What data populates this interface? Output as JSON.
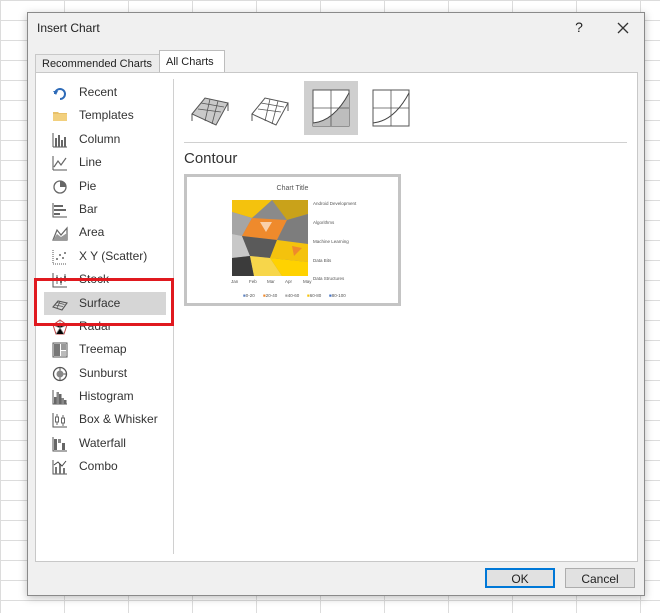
{
  "dialog": {
    "title": "Insert Chart",
    "help": "?",
    "tabs": [
      {
        "label": "Recommended Charts"
      },
      {
        "label": "All Charts"
      }
    ]
  },
  "sidebar": {
    "items": [
      {
        "label": "Recent",
        "icon": "recent-icon"
      },
      {
        "label": "Templates",
        "icon": "folder-icon"
      },
      {
        "label": "Column",
        "icon": "column-chart-icon"
      },
      {
        "label": "Line",
        "icon": "line-chart-icon"
      },
      {
        "label": "Pie",
        "icon": "pie-chart-icon"
      },
      {
        "label": "Bar",
        "icon": "bar-chart-icon"
      },
      {
        "label": "Area",
        "icon": "area-chart-icon"
      },
      {
        "label": "X Y (Scatter)",
        "icon": "scatter-chart-icon"
      },
      {
        "label": "Stock",
        "icon": "stock-chart-icon"
      },
      {
        "label": "Surface",
        "icon": "surface-chart-icon",
        "selected": true
      },
      {
        "label": "Radar",
        "icon": "radar-chart-icon"
      },
      {
        "label": "Treemap",
        "icon": "treemap-chart-icon"
      },
      {
        "label": "Sunburst",
        "icon": "sunburst-chart-icon"
      },
      {
        "label": "Histogram",
        "icon": "histogram-chart-icon"
      },
      {
        "label": "Box & Whisker",
        "icon": "box-whisker-chart-icon"
      },
      {
        "label": "Waterfall",
        "icon": "waterfall-chart-icon"
      },
      {
        "label": "Combo",
        "icon": "combo-chart-icon"
      }
    ]
  },
  "main": {
    "subtypes": [
      {
        "icon": "3d-surface-icon"
      },
      {
        "icon": "wireframe-3d-surface-icon"
      },
      {
        "icon": "contour-icon",
        "selected": true
      },
      {
        "icon": "wireframe-contour-icon"
      }
    ],
    "section_title": "Contour",
    "preview": {
      "title": "Chart Title",
      "right_labels": [
        "Android Development",
        "Algorithms",
        "Machine Learning",
        "Data Bits",
        "Data Structures"
      ],
      "x_labels": [
        "Jan",
        "Feb",
        "Mar",
        "Apr",
        "May"
      ],
      "legend": [
        "0-20",
        "20-40",
        "40-60",
        "60-80",
        "80-100"
      ],
      "legend_colors": [
        "#5b7fbd",
        "#ef8a2c",
        "#a5a5a5",
        "#f4c20d",
        "#4472c4"
      ]
    }
  },
  "buttons": {
    "ok": "OK",
    "cancel": "Cancel"
  },
  "colors": {
    "highlight": "#e0191f",
    "selected_bg": "#d6d6d6"
  }
}
